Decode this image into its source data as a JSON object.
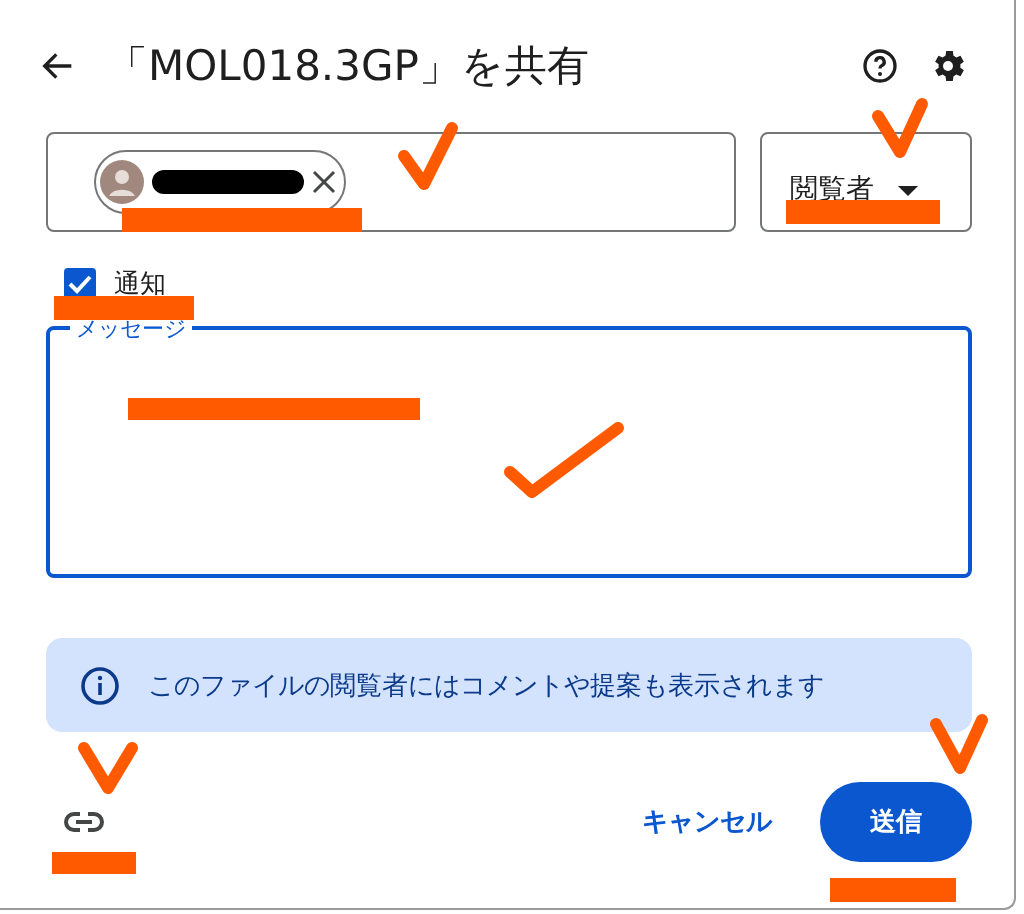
{
  "dialog": {
    "title": "「MOL018.3GP」を共有"
  },
  "recipient_field": {
    "chips": [
      {
        "redacted": true
      }
    ]
  },
  "role_dropdown": {
    "value": "閲覧者"
  },
  "notify": {
    "label": "通知",
    "checked": true
  },
  "message_field": {
    "label": "メッセージ"
  },
  "info_banner": {
    "text": "このファイルの閲覧者にはコメントや提案も表示されます"
  },
  "buttons": [
    {
      "kind": "text",
      "label": "キャンセル"
    },
    {
      "kind": "filled",
      "label": "送信"
    }
  ]
}
